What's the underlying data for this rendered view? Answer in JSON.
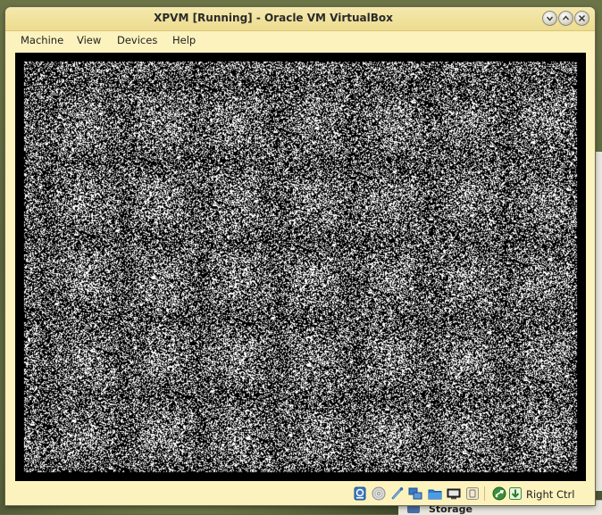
{
  "window": {
    "title": "XPVM [Running] - Oracle VM VirtualBox"
  },
  "menu": {
    "items": [
      "Machine",
      "View",
      "Devices",
      "Help"
    ]
  },
  "status_bar": {
    "host_key_label": "Right Ctrl",
    "icons": [
      "hard-disk-icon",
      "optical-drive-icon",
      "usb-icon",
      "network-icon",
      "shared-folders-icon",
      "display-icon",
      "video-capture-icon",
      "mouse-integration-icon",
      "host-key-icon"
    ]
  },
  "background_window": {
    "section_label": "Storage"
  },
  "colors": {
    "window_bg": "#fbf2bd",
    "title_bar": "#eddc8f",
    "guest_fg": "#ffffff",
    "guest_bg": "#000000"
  }
}
